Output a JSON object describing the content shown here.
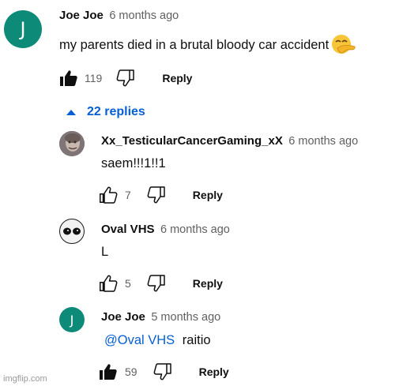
{
  "comment": {
    "author": "Joe Joe",
    "time": "6 months ago",
    "avatar_letter": "J",
    "text": "my parents died in a brutal bloody car accident",
    "emoji_icon": "hand-over-mouth-emoji",
    "likes": "119",
    "liked": true,
    "reply_label": "Reply"
  },
  "replies_toggle": {
    "label": "22 replies",
    "icon": "caret-up-icon"
  },
  "replies": [
    {
      "author": "Xx_TesticularCancerGaming_xX",
      "time": "6 months ago",
      "text": "saem!!!1!!1",
      "likes": "7",
      "liked": false,
      "reply_label": "Reply"
    },
    {
      "author": "Oval VHS",
      "time": "6 months ago",
      "text": "L",
      "likes": "5",
      "liked": false,
      "reply_label": "Reply"
    },
    {
      "author": "Joe Joe",
      "time": "5 months ago",
      "avatar_letter": "J",
      "mention": "@Oval VHS",
      "text": "raitio",
      "likes": "59",
      "liked": true,
      "reply_label": "Reply"
    }
  ],
  "watermark": "imgflip.com",
  "colors": {
    "avatar_green": "#0e8a78",
    "link_blue": "#065fd4",
    "secondary_text": "#606060"
  }
}
